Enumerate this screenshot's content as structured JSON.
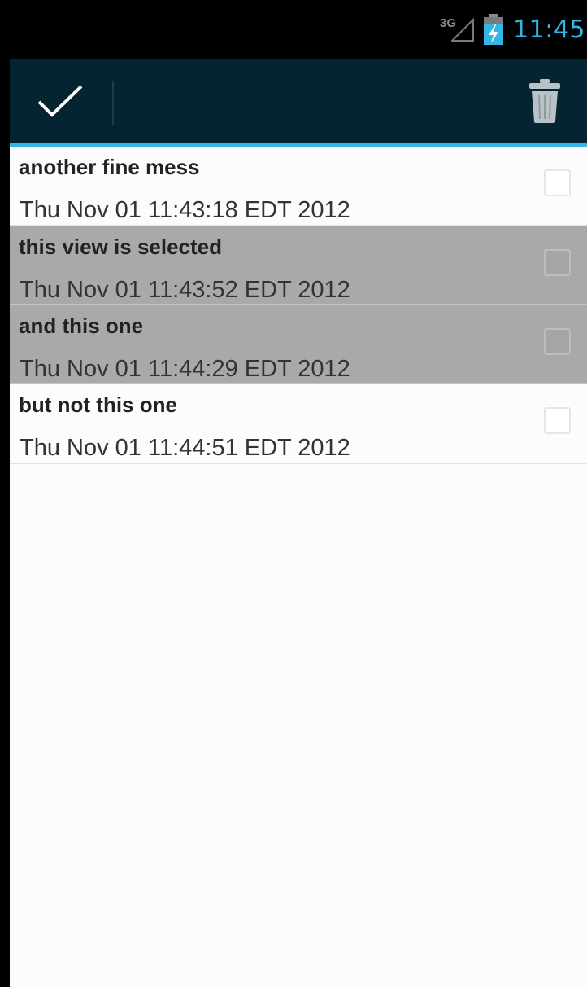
{
  "status_bar": {
    "network_type": "3G",
    "time": "11:45",
    "icons": [
      "signal-icon",
      "battery-charging-icon"
    ]
  },
  "action_bar": {
    "done_icon": "checkmark-icon",
    "delete_icon": "trash-icon",
    "background": "#052432",
    "accent": "#33b5e5"
  },
  "list": {
    "items": [
      {
        "title": "another fine mess",
        "date": "Thu Nov 01 11:43:18 EDT 2012",
        "selected": false,
        "checked": false
      },
      {
        "title": "this view is selected",
        "date": "Thu Nov 01 11:43:52 EDT 2012",
        "selected": true,
        "checked": false
      },
      {
        "title": "and this one",
        "date": "Thu Nov 01 11:44:29 EDT 2012",
        "selected": true,
        "checked": false
      },
      {
        "title": "but not this one",
        "date": "Thu Nov 01 11:44:51 EDT 2012",
        "selected": false,
        "checked": false
      }
    ],
    "selected_color": "#aaa9aa"
  }
}
